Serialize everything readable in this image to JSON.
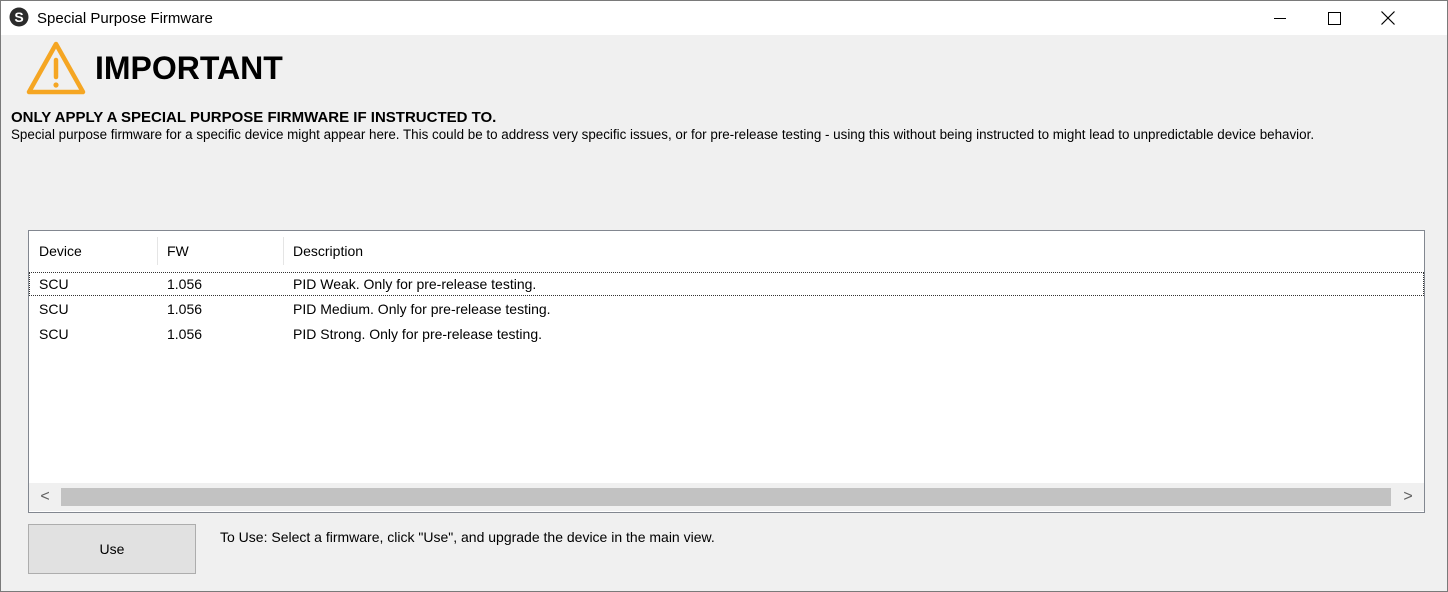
{
  "window": {
    "title": "Special Purpose Firmware",
    "icon": "s-logo-icon",
    "controls": {
      "minimize": "—",
      "maximize": "☐",
      "close": "✕"
    }
  },
  "warning": {
    "icon": "warning-triangle-icon",
    "icon_color": "#f5a623",
    "heading": "IMPORTANT",
    "subheading": "ONLY APPLY A SPECIAL PURPOSE FIRMWARE IF INSTRUCTED TO.",
    "description": "Special purpose firmware for a specific device might appear here. This could be to address very specific issues, or for pre-release testing - using this without being instructed to might lead to unpredictable device behavior."
  },
  "firmware_list": {
    "columns": [
      "Device",
      "FW",
      "Description"
    ],
    "rows": [
      {
        "device": "SCU",
        "fw": "1.056",
        "description": "PID Weak. Only for pre-release testing."
      },
      {
        "device": "SCU",
        "fw": "1.056",
        "description": "PID Medium. Only for pre-release testing."
      },
      {
        "device": "SCU",
        "fw": "1.056",
        "description": "PID Strong. Only for pre-release testing."
      }
    ],
    "scroll_left": "<",
    "scroll_right": ">"
  },
  "footer": {
    "use_button": "Use",
    "hint": "To Use: Select a firmware, click \"Use\", and upgrade the device in the main view."
  }
}
